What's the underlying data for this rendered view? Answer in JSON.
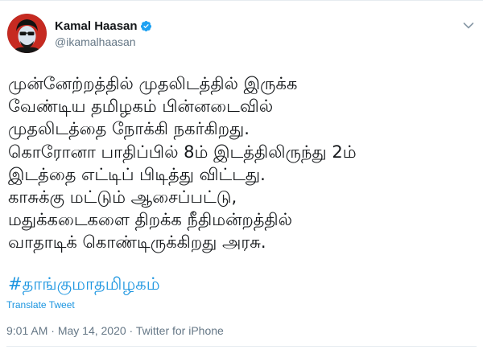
{
  "tweet": {
    "author": {
      "name": "Kamal Haasan",
      "handle": "@ikamalhaasan",
      "verified": true,
      "avatar_icon": "avatar-portrait-icon"
    },
    "text": "முன்னேற்றத்தில் முதலிடத்தில் இருக்க\nவேண்டிய தமிழகம் பின்னடைவில்\nமுதலிடத்தை நோக்கி நகர்கிறது.\nகொரோனா பாதிப்பில் 8ம் இடத்திலிருந்து 2ம்\nஇடத்தை எட்டிப் பிடித்து விட்டது.\nகாசுக்கு மட்டும் ஆசைப்பட்டு,\nமதுக்கடைகளை திறக்க நீதிமன்றத்தில்\nவாதாடிக் கொண்டிருக்கிறது அரசு.",
    "hashtag": "#தாங்குமாதமிழகம்",
    "translate_label": "Translate Tweet",
    "time": "9:01 AM",
    "separator": " · ",
    "date": "May 14, 2020",
    "source": "Twitter for iPhone"
  },
  "colors": {
    "text": "#14171a",
    "secondary": "#657786",
    "accent": "#1b95e0",
    "verified": "#1da1f2",
    "border": "#e6ecf0"
  },
  "icons": {
    "verified": "verified-badge-icon",
    "menu": "chevron-down-icon"
  }
}
